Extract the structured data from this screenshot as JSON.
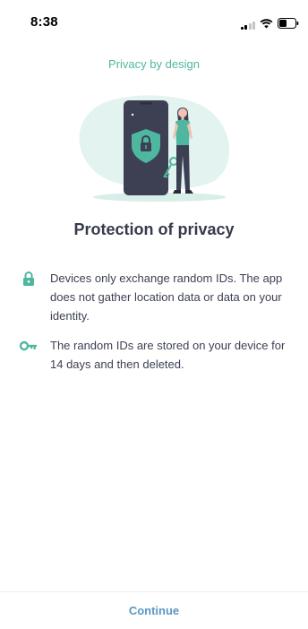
{
  "status_bar": {
    "time": "8:38"
  },
  "header": {
    "label": "Privacy by design"
  },
  "illustration": {
    "icon": "phone-shield-person-illustration",
    "accent_color": "#4fb7a0",
    "phone_color": "#3d3f52"
  },
  "title": "Protection of privacy",
  "info_items": [
    {
      "icon": "lock-icon",
      "text": "Devices only exchange random IDs. The app does not gather location data or data on your identity."
    },
    {
      "icon": "key-icon",
      "text": "The random IDs are stored on your device for 14 days and then deleted."
    }
  ],
  "footer": {
    "continue_label": "Continue",
    "button_color": "#5e97c2"
  }
}
